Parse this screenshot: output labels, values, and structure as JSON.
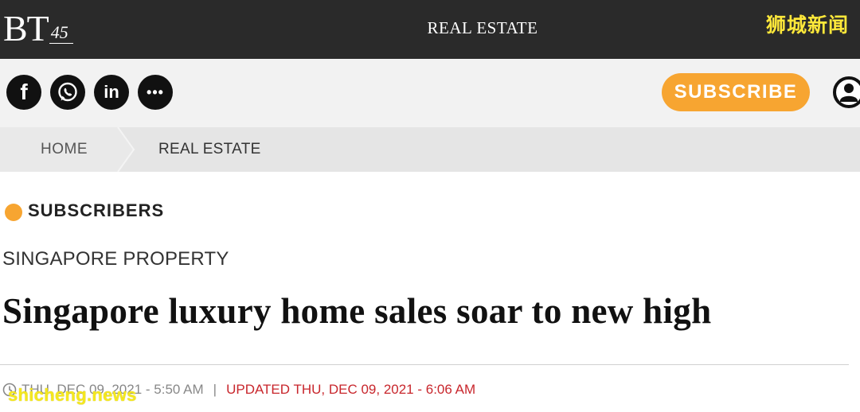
{
  "topbar": {
    "logo_text": "BT",
    "logo_anniversary": "45",
    "section_title": "REAL ESTATE",
    "watermark": "狮城新闻"
  },
  "share": {
    "facebook_glyph": "f",
    "linkedin_glyph": "in",
    "more_glyph": "•••",
    "icons": [
      "facebook-icon",
      "whatsapp-icon",
      "linkedin-icon",
      "more-icon"
    ]
  },
  "subscribe": {
    "label": "SUBSCRIBE",
    "color": "#f7a531"
  },
  "breadcrumb": {
    "home": "HOME",
    "current": "REAL ESTATE"
  },
  "article": {
    "badge_label": "SUBSCRIBERS",
    "badge_color": "#f7a531",
    "category": "SINGAPORE PROPERTY",
    "headline": "Singapore luxury home sales soar to new high",
    "published": "THU, DEC 09, 2021 - 5:50 AM",
    "separator": "|",
    "updated": "UPDATED THU, DEC 09, 2021 - 6:06 AM",
    "updated_color": "#c8262c"
  },
  "watermark_bottom": "shicheng.news"
}
